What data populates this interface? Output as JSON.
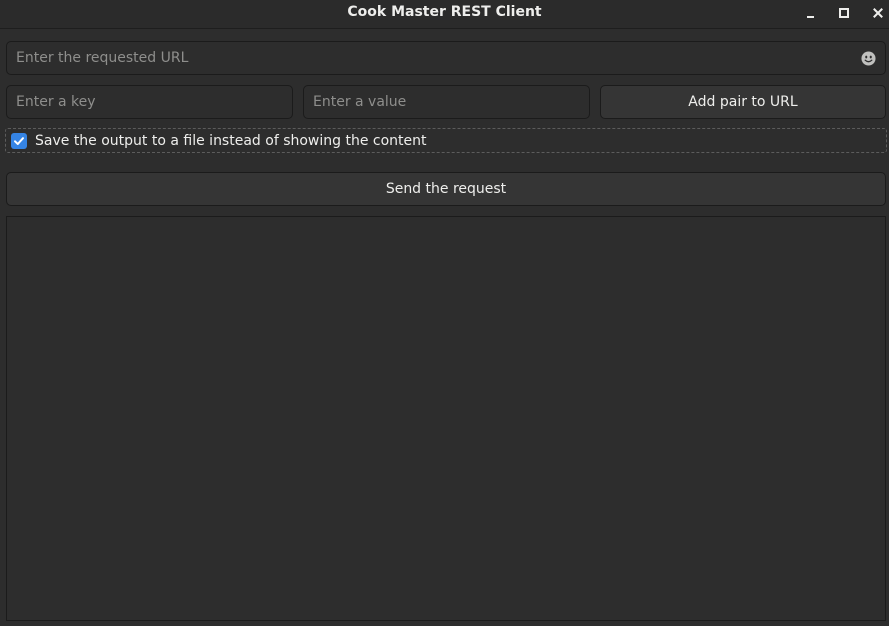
{
  "window": {
    "title": "Cook Master REST Client",
    "controls": [
      "minimize",
      "maximize",
      "close"
    ]
  },
  "url_field": {
    "placeholder": "Enter the requested URL",
    "value": "",
    "icon": "emoji-icon"
  },
  "key_field": {
    "placeholder": "Enter a key",
    "value": ""
  },
  "value_field": {
    "placeholder": "Enter a value",
    "value": ""
  },
  "add_pair_button": {
    "label": "Add pair to URL"
  },
  "save_to_file": {
    "label": "Save the output to a file instead of showing the content",
    "checked": true
  },
  "send_button": {
    "label": "Send the request"
  },
  "output": {
    "content": ""
  },
  "colors": {
    "background": "#2d2d2d",
    "accent": "#3584e4",
    "text": "#eeeeec",
    "placeholder": "#8e8e8c"
  }
}
